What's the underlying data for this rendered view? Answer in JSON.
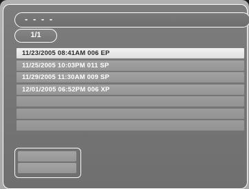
{
  "header": {
    "title": "- - - -",
    "page_indicator": "1/1"
  },
  "list": {
    "selected_index": 0,
    "items": [
      {
        "label": "11/23/2005 08:41AM 006 EP"
      },
      {
        "label": "11/25/2005 10:03PM 011 SP"
      },
      {
        "label": "11/29/2005 11:30AM 009 SP"
      },
      {
        "label": "12/01/2005 06:52PM 006 XP"
      },
      {
        "label": ""
      },
      {
        "label": ""
      },
      {
        "label": ""
      }
    ]
  },
  "colors": {
    "selected_row": "#e8e8e8",
    "row": "#9b9b9b",
    "panel": "#777777",
    "outline": "#ffffff"
  }
}
